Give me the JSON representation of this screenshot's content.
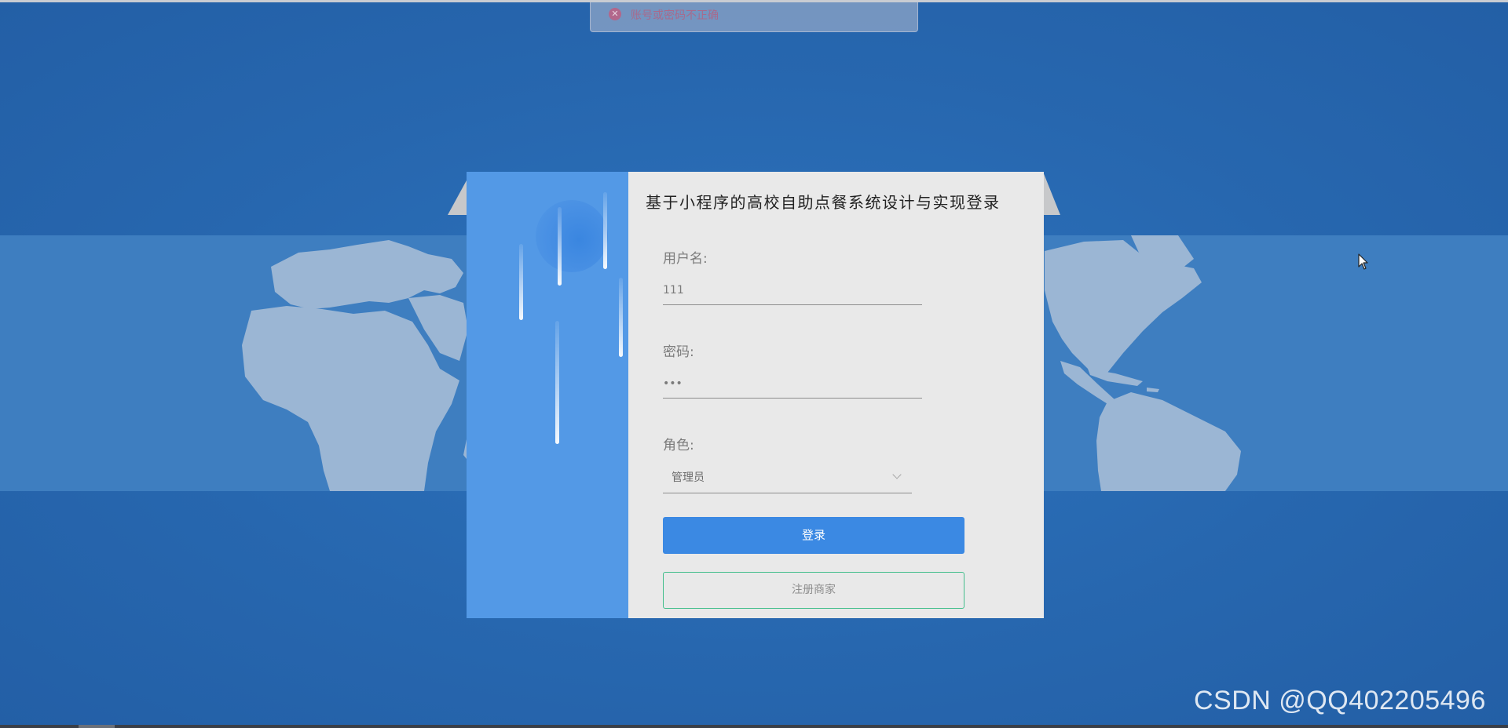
{
  "toast": {
    "icon": "error-circle-icon",
    "message": "账号或密码不正确",
    "color": "#a86a8c"
  },
  "login": {
    "title": "基于小程序的高校自助点餐系统设计与实现登录",
    "username_label": "用户名:",
    "username_value": "111",
    "password_label": "密码:",
    "password_value": "•••",
    "role_label": "角色:",
    "role_value": "管理员",
    "login_button": "登录",
    "register_button": "注册商家"
  },
  "colors": {
    "background": "#2767af",
    "panel_accent": "#5399e6",
    "login_button": "#3b89e3",
    "register_border": "#43be8c"
  },
  "watermark": "CSDN @QQ402205496"
}
